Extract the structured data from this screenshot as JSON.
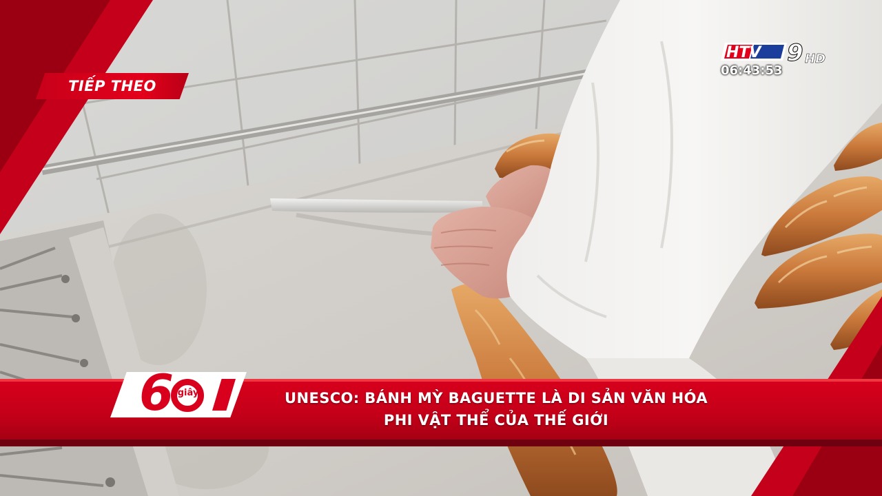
{
  "overlay": {
    "next_label": "TIẾP THEO",
    "clock": "06:43:53"
  },
  "channel_logo": {
    "name": "HTV9",
    "hd": "HD",
    "colors": {
      "red": "#e3001b",
      "blue": "#1b3d9c",
      "white": "#ffffff"
    }
  },
  "program_logo": {
    "number": "60",
    "unit": "giây"
  },
  "headline": {
    "line1": "UNESCO: BÁNH MỲ BAGUETTE LÀ DI SẢN VĂN HÓA",
    "line2": "PHI VẬT THỂ CỦA THẾ GIỚI"
  },
  "colors": {
    "accent_red": "#d8001c",
    "dark_red": "#8a0010"
  }
}
